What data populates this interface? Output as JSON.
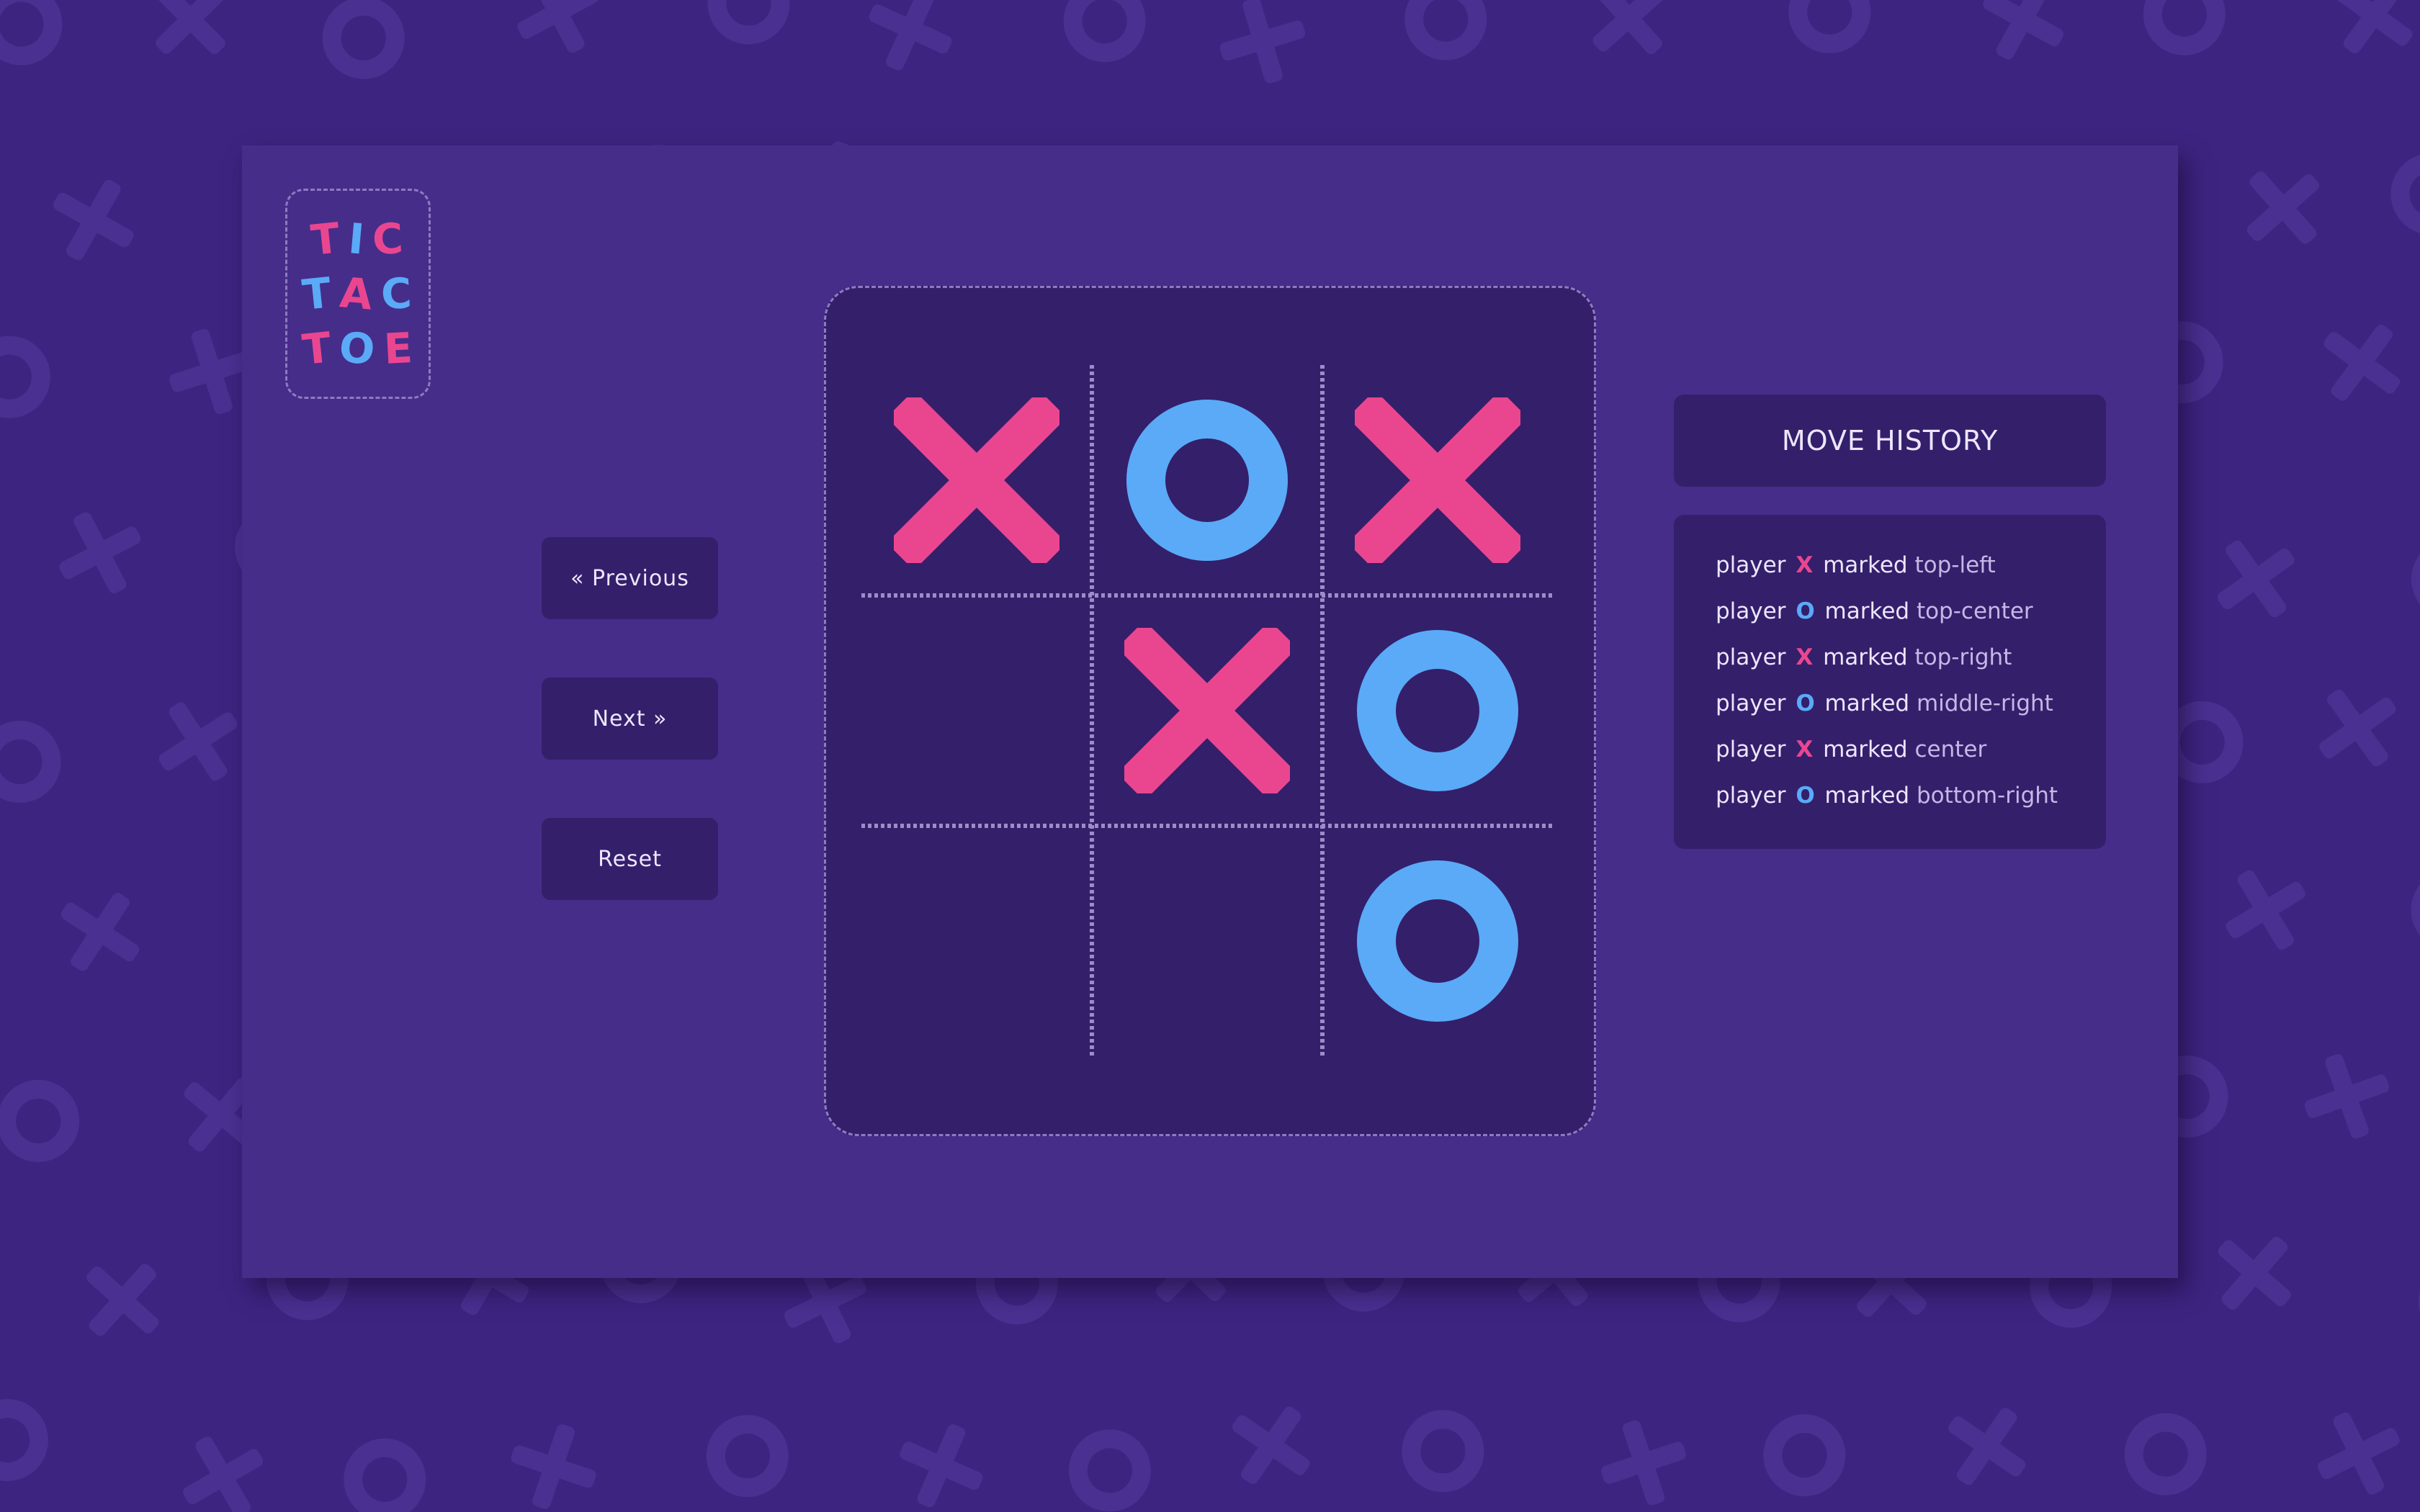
{
  "colors": {
    "x": "#ea4690",
    "o": "#5aaaf7",
    "background": "#3d2480",
    "card": "#462d8a",
    "panel": "#341f6b"
  },
  "logo": {
    "lines": [
      [
        {
          "char": "T",
          "color": "#ea4690"
        },
        {
          "char": "I",
          "color": "#5aaaf7"
        },
        {
          "char": "C",
          "color": "#ea4690"
        }
      ],
      [
        {
          "char": "T",
          "color": "#5aaaf7"
        },
        {
          "char": "A",
          "color": "#ea4690"
        },
        {
          "char": "C",
          "color": "#5aaaf7"
        }
      ],
      [
        {
          "char": "T",
          "color": "#ea4690"
        },
        {
          "char": "O",
          "color": "#5aaaf7"
        },
        {
          "char": "E",
          "color": "#ea4690"
        }
      ]
    ]
  },
  "controls": {
    "previous_label": "« Previous",
    "next_label": "Next »",
    "reset_label": "Reset"
  },
  "board": {
    "cells": [
      "X",
      "O",
      "X",
      "",
      "X",
      "O",
      "",
      "",
      "O"
    ]
  },
  "history": {
    "title": "MOVE HISTORY",
    "moves": [
      {
        "prefix": "player",
        "mark": "X",
        "verb": "marked",
        "position": "top-left"
      },
      {
        "prefix": "player",
        "mark": "O",
        "verb": "marked",
        "position": "top-center"
      },
      {
        "prefix": "player",
        "mark": "X",
        "verb": "marked",
        "position": "top-right"
      },
      {
        "prefix": "player",
        "mark": "O",
        "verb": "marked",
        "position": "middle-right"
      },
      {
        "prefix": "player",
        "mark": "X",
        "verb": "marked",
        "position": "center"
      },
      {
        "prefix": "player",
        "mark": "O",
        "verb": "marked",
        "position": "bottom-right"
      }
    ]
  }
}
